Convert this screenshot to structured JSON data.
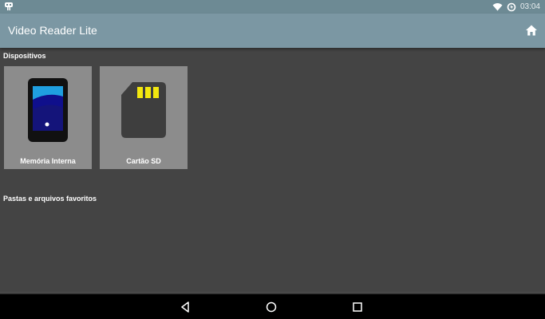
{
  "status_bar": {
    "time": "03:04",
    "icons": [
      "notification-icon",
      "wifi-icon",
      "battery-icon"
    ]
  },
  "app_bar": {
    "title": "Video Reader Lite",
    "home_icon": "home-icon"
  },
  "sections": {
    "devices": {
      "title": "Dispositivos",
      "items": [
        {
          "label": "Memória Interna",
          "icon": "phone-icon"
        },
        {
          "label": "Cartão SD",
          "icon": "sd-card-icon"
        }
      ]
    },
    "favorites": {
      "title": "Pastas e arquivos favoritos"
    }
  },
  "nav_bar": {
    "icons": [
      "back-icon",
      "home-icon",
      "recents-icon"
    ]
  },
  "colors": {
    "background": "#444444",
    "app_bar": "#7b97a3",
    "status_bar": "#6d8a94",
    "tile": "#8c8c8c",
    "sd_contacts": "#f2e70f",
    "phone_screen": "#1f9fe0"
  }
}
